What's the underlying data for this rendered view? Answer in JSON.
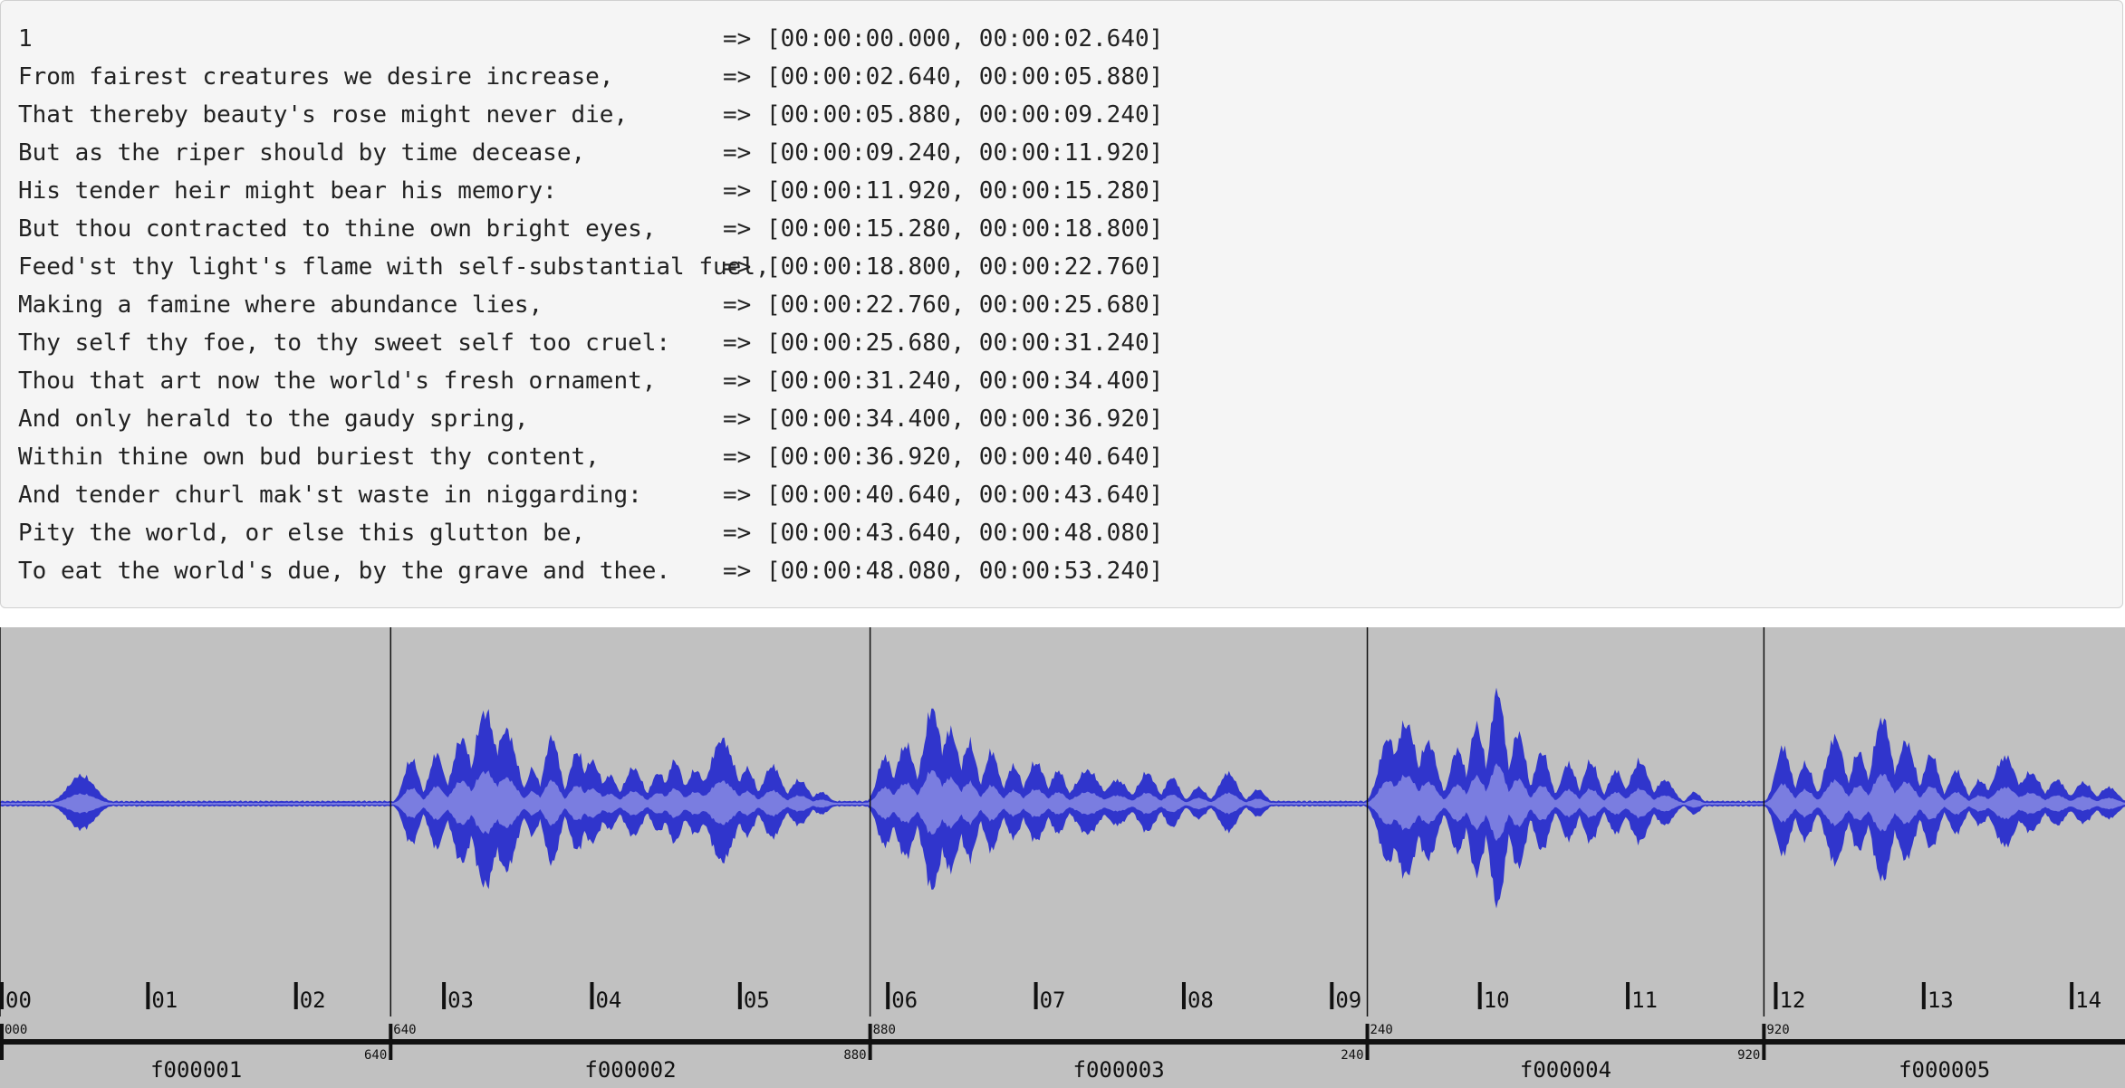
{
  "transcript": {
    "arrow": "=>",
    "rows": [
      {
        "text": "1",
        "start": "00:00:00.000",
        "end": "00:00:02.640"
      },
      {
        "text": "From fairest creatures we desire increase,",
        "start": "00:00:02.640",
        "end": "00:00:05.880"
      },
      {
        "text": "That thereby beauty's rose might never die,",
        "start": "00:00:05.880",
        "end": "00:00:09.240"
      },
      {
        "text": "But as the riper should by time decease,",
        "start": "00:00:09.240",
        "end": "00:00:11.920"
      },
      {
        "text": "His tender heir might bear his memory:",
        "start": "00:00:11.920",
        "end": "00:00:15.280"
      },
      {
        "text": "But thou contracted to thine own bright eyes,",
        "start": "00:00:15.280",
        "end": "00:00:18.800"
      },
      {
        "text": "Feed'st thy light's flame with self-substantial fuel,",
        "start": "00:00:18.800",
        "end": "00:00:22.760"
      },
      {
        "text": "Making a famine where abundance lies,",
        "start": "00:00:22.760",
        "end": "00:00:25.680"
      },
      {
        "text": "Thy self thy foe, to thy sweet self too cruel:",
        "start": "00:00:25.680",
        "end": "00:00:31.240"
      },
      {
        "text": "Thou that art now the world's fresh ornament,",
        "start": "00:00:31.240",
        "end": "00:00:34.400"
      },
      {
        "text": "And only herald to the gaudy spring,",
        "start": "00:00:34.400",
        "end": "00:00:36.920"
      },
      {
        "text": "Within thine own bud buriest thy content,",
        "start": "00:00:36.920",
        "end": "00:00:40.640"
      },
      {
        "text": "And tender churl mak'st waste in niggarding:",
        "start": "00:00:40.640",
        "end": "00:00:43.640"
      },
      {
        "text": "Pity the world, or else this glutton be,",
        "start": "00:00:43.640",
        "end": "00:00:48.080"
      },
      {
        "text": "To eat the world's due, by the grave and thee.",
        "start": "00:00:48.080",
        "end": "00:00:53.240"
      }
    ]
  },
  "waveform": {
    "colors": {
      "background": "#c1c1c1",
      "wave_outer": "#3035cc",
      "wave_inner": "#7a7de0",
      "lines": "#111111"
    },
    "view_start_seconds": 0.0,
    "view_end_seconds": 14.36,
    "second_ticks": [
      {
        "t": 0,
        "label": "00"
      },
      {
        "t": 1,
        "label": "01"
      },
      {
        "t": 2,
        "label": "02"
      },
      {
        "t": 3,
        "label": "03"
      },
      {
        "t": 4,
        "label": "04"
      },
      {
        "t": 5,
        "label": "05"
      },
      {
        "t": 6,
        "label": "06"
      },
      {
        "t": 7,
        "label": "07"
      },
      {
        "t": 8,
        "label": "08"
      },
      {
        "t": 9,
        "label": "09"
      },
      {
        "t": 10,
        "label": "10"
      },
      {
        "t": 11,
        "label": "11"
      },
      {
        "t": 12,
        "label": "12"
      },
      {
        "t": 13,
        "label": "13"
      },
      {
        "t": 14,
        "label": "14"
      }
    ],
    "fragments": [
      {
        "id": "f000001",
        "begin": 0.0,
        "end": 2.64,
        "begin_label": "000",
        "end_label": "640"
      },
      {
        "id": "f000002",
        "begin": 2.64,
        "end": 5.88,
        "begin_label": "640",
        "end_label": "880"
      },
      {
        "id": "f000003",
        "begin": 5.88,
        "end": 9.24,
        "begin_label": "880",
        "end_label": "240"
      },
      {
        "id": "f000004",
        "begin": 9.24,
        "end": 11.92,
        "begin_label": "240",
        "end_label": "920"
      },
      {
        "id": "f000005",
        "begin": 11.92,
        "end": 15.28,
        "begin_label": "920",
        "end_label": ""
      }
    ],
    "bursts": [
      {
        "t": 0.55,
        "w": 0.09,
        "a": 0.24
      },
      {
        "t": 0.62,
        "w": 0.05,
        "a": 0.16
      },
      {
        "t": 2.78,
        "w": 0.05,
        "a": 0.38
      },
      {
        "t": 2.95,
        "w": 0.05,
        "a": 0.42
      },
      {
        "t": 3.12,
        "w": 0.06,
        "a": 0.55
      },
      {
        "t": 3.28,
        "w": 0.07,
        "a": 0.78
      },
      {
        "t": 3.42,
        "w": 0.07,
        "a": 0.62
      },
      {
        "t": 3.6,
        "w": 0.04,
        "a": 0.3
      },
      {
        "t": 3.73,
        "w": 0.05,
        "a": 0.56
      },
      {
        "t": 3.9,
        "w": 0.05,
        "a": 0.44
      },
      {
        "t": 4.0,
        "w": 0.06,
        "a": 0.36
      },
      {
        "t": 4.12,
        "w": 0.05,
        "a": 0.24
      },
      {
        "t": 4.28,
        "w": 0.06,
        "a": 0.3
      },
      {
        "t": 4.45,
        "w": 0.05,
        "a": 0.26
      },
      {
        "t": 4.56,
        "w": 0.05,
        "a": 0.36
      },
      {
        "t": 4.7,
        "w": 0.06,
        "a": 0.28
      },
      {
        "t": 4.88,
        "w": 0.08,
        "a": 0.54
      },
      {
        "t": 5.05,
        "w": 0.05,
        "a": 0.3
      },
      {
        "t": 5.22,
        "w": 0.06,
        "a": 0.32
      },
      {
        "t": 5.4,
        "w": 0.06,
        "a": 0.2
      },
      {
        "t": 5.55,
        "w": 0.05,
        "a": 0.1
      },
      {
        "t": 5.98,
        "w": 0.05,
        "a": 0.4
      },
      {
        "t": 6.12,
        "w": 0.06,
        "a": 0.5
      },
      {
        "t": 6.3,
        "w": 0.06,
        "a": 0.8
      },
      {
        "t": 6.42,
        "w": 0.06,
        "a": 0.62
      },
      {
        "t": 6.55,
        "w": 0.05,
        "a": 0.52
      },
      {
        "t": 6.7,
        "w": 0.05,
        "a": 0.44
      },
      {
        "t": 6.85,
        "w": 0.05,
        "a": 0.32
      },
      {
        "t": 7.0,
        "w": 0.06,
        "a": 0.35
      },
      {
        "t": 7.15,
        "w": 0.05,
        "a": 0.28
      },
      {
        "t": 7.35,
        "w": 0.08,
        "a": 0.28
      },
      {
        "t": 7.55,
        "w": 0.07,
        "a": 0.2
      },
      {
        "t": 7.75,
        "w": 0.06,
        "a": 0.26
      },
      {
        "t": 7.92,
        "w": 0.05,
        "a": 0.22
      },
      {
        "t": 8.1,
        "w": 0.05,
        "a": 0.14
      },
      {
        "t": 8.3,
        "w": 0.06,
        "a": 0.26
      },
      {
        "t": 8.5,
        "w": 0.05,
        "a": 0.12
      },
      {
        "t": 9.38,
        "w": 0.06,
        "a": 0.55
      },
      {
        "t": 9.5,
        "w": 0.07,
        "a": 0.68
      },
      {
        "t": 9.65,
        "w": 0.06,
        "a": 0.52
      },
      {
        "t": 9.85,
        "w": 0.05,
        "a": 0.46
      },
      {
        "t": 9.98,
        "w": 0.05,
        "a": 0.66
      },
      {
        "t": 10.12,
        "w": 0.05,
        "a": 0.95
      },
      {
        "t": 10.26,
        "w": 0.05,
        "a": 0.6
      },
      {
        "t": 10.42,
        "w": 0.05,
        "a": 0.44
      },
      {
        "t": 10.6,
        "w": 0.05,
        "a": 0.34
      },
      {
        "t": 10.75,
        "w": 0.05,
        "a": 0.36
      },
      {
        "t": 10.92,
        "w": 0.05,
        "a": 0.28
      },
      {
        "t": 11.08,
        "w": 0.06,
        "a": 0.36
      },
      {
        "t": 11.25,
        "w": 0.06,
        "a": 0.2
      },
      {
        "t": 11.45,
        "w": 0.04,
        "a": 0.1
      },
      {
        "t": 12.05,
        "w": 0.05,
        "a": 0.48
      },
      {
        "t": 12.2,
        "w": 0.05,
        "a": 0.34
      },
      {
        "t": 12.4,
        "w": 0.06,
        "a": 0.56
      },
      {
        "t": 12.56,
        "w": 0.05,
        "a": 0.44
      },
      {
        "t": 12.72,
        "w": 0.06,
        "a": 0.72
      },
      {
        "t": 12.88,
        "w": 0.06,
        "a": 0.52
      },
      {
        "t": 13.05,
        "w": 0.05,
        "a": 0.42
      },
      {
        "t": 13.22,
        "w": 0.05,
        "a": 0.28
      },
      {
        "t": 13.38,
        "w": 0.05,
        "a": 0.2
      },
      {
        "t": 13.55,
        "w": 0.07,
        "a": 0.4
      },
      {
        "t": 13.72,
        "w": 0.07,
        "a": 0.26
      },
      {
        "t": 13.9,
        "w": 0.06,
        "a": 0.2
      },
      {
        "t": 14.08,
        "w": 0.06,
        "a": 0.18
      },
      {
        "t": 14.25,
        "w": 0.06,
        "a": 0.14
      }
    ]
  }
}
